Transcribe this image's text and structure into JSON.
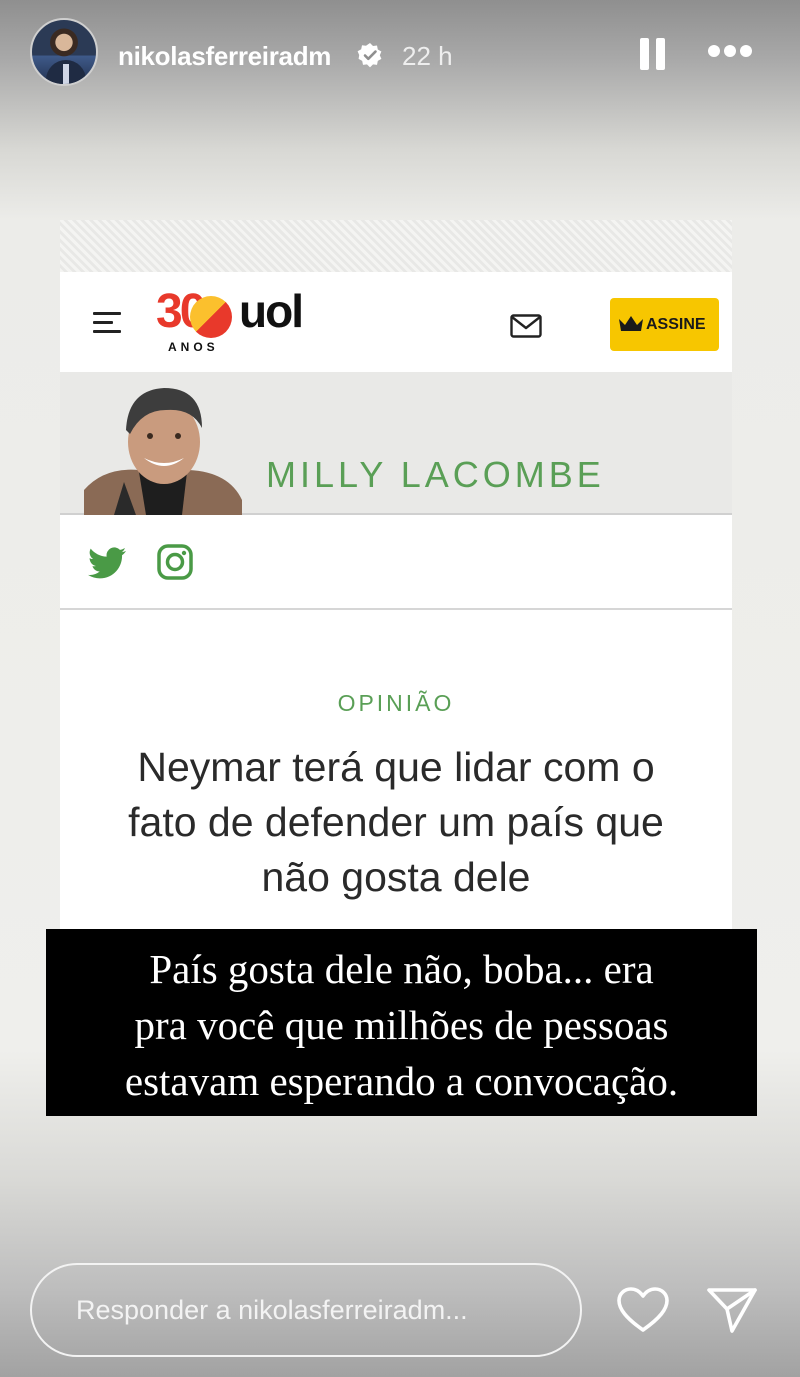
{
  "story": {
    "username": "nikolasferreiradm",
    "time_ago": "22 h"
  },
  "uol": {
    "logo_number": "30",
    "logo_brand": "uol",
    "logo_sub": "ANOS",
    "subscribe_label": "ASSINE"
  },
  "article": {
    "author_name": "MILLY LACOMBE",
    "section": "OPINIÃO",
    "headline_lines": [
      "Neymar terá que lidar com o",
      "fato de defender um país que",
      "não gosta dele"
    ]
  },
  "caption_lines": [
    "País gosta dele não, boba... era",
    "pra você que milhões de pessoas",
    "estavam esperando a convocação."
  ],
  "reply": {
    "placeholder": "Responder a nikolasferreiradm..."
  },
  "colors": {
    "uol_green": "#5a9f56",
    "subscribe_yellow": "#f7c600",
    "uol_red": "#e8392b"
  }
}
